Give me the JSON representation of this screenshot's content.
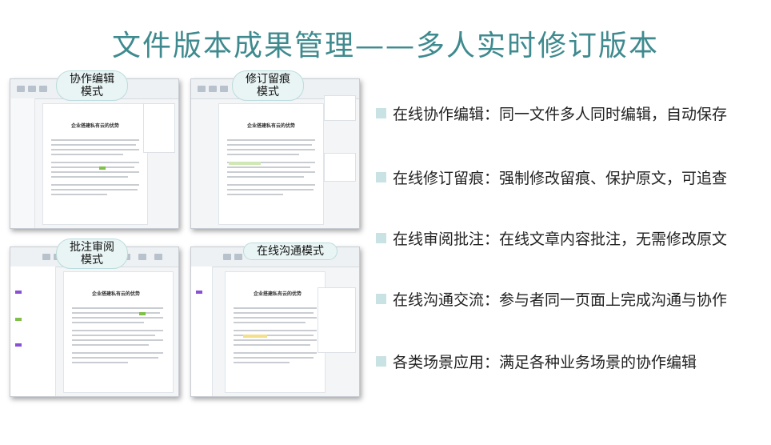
{
  "title": "文件版本成果管理——多人实时修订版本",
  "screens": [
    {
      "mode": "协作编辑\n模式",
      "doc_title": "企业搭建私有云的优势"
    },
    {
      "mode": "修订留痕\n模式",
      "doc_title": "企业搭建私有云的优势"
    },
    {
      "mode": "批注审阅\n模式",
      "doc_title": "企业搭建私有云的优势"
    },
    {
      "mode": "在线沟通模式",
      "doc_title": "企业搭建私有云的优势"
    }
  ],
  "features": [
    "在线协作编辑：同一文件多人同时编辑，自动保存",
    "在线修订留痕：强制修改留痕、保护原文，可追查",
    "在线审阅批注：在线文章内容批注，无需修改原文",
    "在线沟通交流：参与者同一页面上完成沟通与协作",
    "各类场景应用：满足各种业务场景的协作编辑"
  ],
  "colors": {
    "title": "#3e8a8e",
    "bullet": "#c9e2e3",
    "label_bg": "#e9f4f4"
  }
}
